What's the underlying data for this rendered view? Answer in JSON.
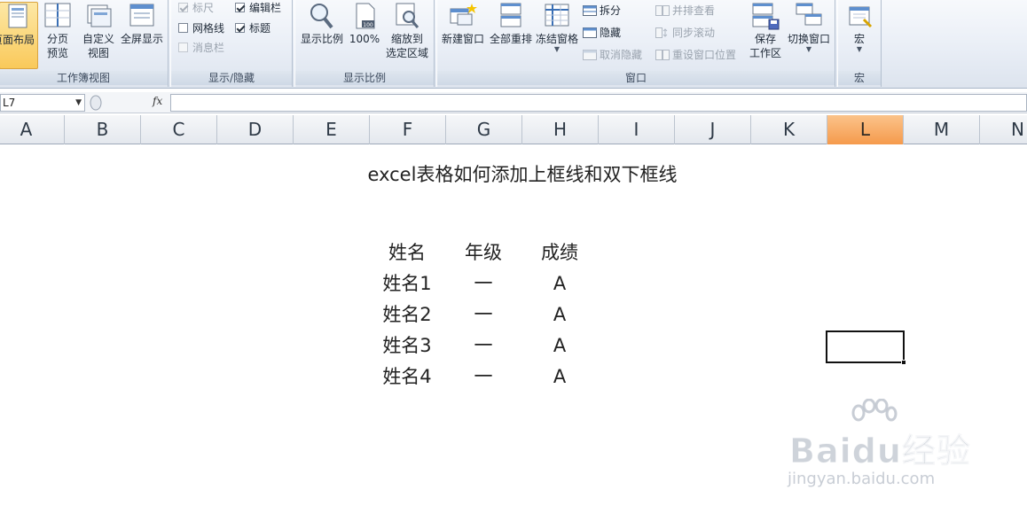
{
  "ribbon": {
    "groups": {
      "workbook_views": {
        "label": "工作簿视图",
        "page_layout": "页面布局",
        "page_break_1": "分页",
        "page_break_2": "预览",
        "custom_view_1": "自定义",
        "custom_view_2": "视图",
        "full_screen": "全屏显示"
      },
      "show_hide": {
        "label": "显示/隐藏",
        "ruler": "标尺",
        "gridlines": "网格线",
        "message_bar": "消息栏",
        "formula_bar": "编辑栏",
        "headings": "标题"
      },
      "zoom": {
        "label": "显示比例",
        "zoom": "显示比例",
        "hundred": "100%",
        "zoom_to_selection_1": "缩放到",
        "zoom_to_selection_2": "选定区域"
      },
      "window": {
        "label": "窗口",
        "new_window": "新建窗口",
        "arrange_all": "全部重排",
        "freeze_panes": "冻结窗格",
        "split": "拆分",
        "hide": "隐藏",
        "unhide": "取消隐藏",
        "view_side_by_side": "并排查看",
        "sync_scrolling": "同步滚动",
        "reset_window_position": "重设窗口位置",
        "save_workspace_1": "保存",
        "save_workspace_2": "工作区",
        "switch_windows": "切换窗口"
      },
      "macros": {
        "label": "宏",
        "macros": "宏"
      }
    }
  },
  "formula_bar": {
    "name_box": "L7",
    "fx": "fx",
    "value": ""
  },
  "columns": [
    "A",
    "B",
    "C",
    "D",
    "E",
    "F",
    "G",
    "H",
    "I",
    "J",
    "K",
    "L",
    "M",
    "N"
  ],
  "selected_column": "L",
  "sheet": {
    "title": "excel表格如何添加上框线和双下框线",
    "table": {
      "headers": [
        "姓名",
        "年级",
        "成绩"
      ],
      "rows": [
        [
          "姓名1",
          "一",
          "A"
        ],
        [
          "姓名2",
          "一",
          "A"
        ],
        [
          "姓名3",
          "一",
          "A"
        ],
        [
          "姓名4",
          "一",
          "A"
        ]
      ]
    }
  },
  "watermark": {
    "brand": "Baidu经验",
    "url": "jingyan.baidu.com"
  },
  "colors": {
    "selected_column_header": "#f59a4c",
    "active_button": "#f9c95a",
    "ribbon_bg": "#e9eef6"
  }
}
